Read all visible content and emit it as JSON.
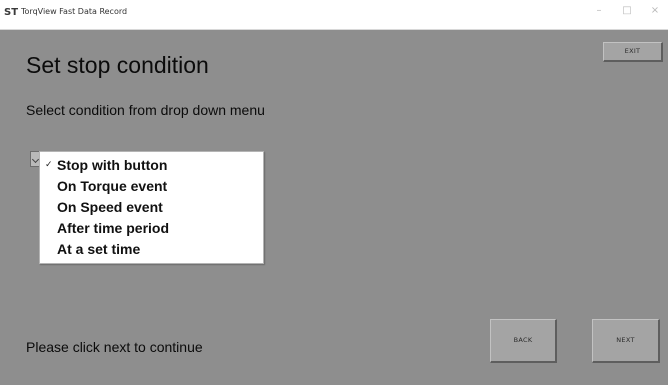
{
  "window": {
    "title": "TorqView Fast Data Record",
    "app_icon_glyph": "ST",
    "controls": {
      "minimize_glyph": "–",
      "maximize_glyph": "□",
      "close_glyph": "×"
    }
  },
  "page": {
    "title": "Set stop condition",
    "subtitle": "Select condition from drop down menu",
    "footer_text": "Please click next to continue"
  },
  "buttons": {
    "exit": "EXIT",
    "back": "BACK",
    "next": "NEXT"
  },
  "dropdown": {
    "selected_index": 0,
    "check_glyph": "✓",
    "options": [
      "Stop with button",
      "On Torque event",
      "On Speed event",
      "After time period",
      "At a set time"
    ]
  },
  "colors": {
    "client_background": "#8e8e8e",
    "button_face": "#a4a4a4",
    "menu_background": "#ffffff"
  }
}
